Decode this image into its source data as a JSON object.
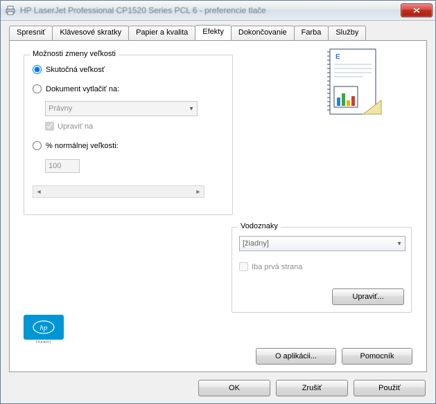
{
  "window": {
    "title": "HP LaserJet Professional CP1520 Series PCL 6 - preferencie tlače"
  },
  "tabs": {
    "spresnit": "Spresniť",
    "klaves": "Klávesové skratky",
    "papier": "Papier a kvalita",
    "efekty": "Efekty",
    "dokon": "Dokončovanie",
    "farba": "Farba",
    "sluzby": "Služby"
  },
  "resize": {
    "legend": "Možnosti zmeny veľkosti",
    "opt_actual": "Skutočná veľkosť",
    "opt_print_on": "Dokument vytlačiť na:",
    "paper_value": "Právny",
    "scale_to_fit": "Upraviť na",
    "opt_percent": "% normálnej veľkosti:",
    "percent_value": "100"
  },
  "watermark": {
    "legend": "Vodoznaky",
    "value": "[žiadny]",
    "first_page": "Iba prvá strana",
    "edit": "Upraviť..."
  },
  "footer": {
    "about": "O aplikácii...",
    "help": "Pomocník",
    "ok": "OK",
    "cancel": "Zrušiť",
    "apply": "Použiť"
  },
  "logo": {
    "text": "hp",
    "sub": "invent"
  }
}
